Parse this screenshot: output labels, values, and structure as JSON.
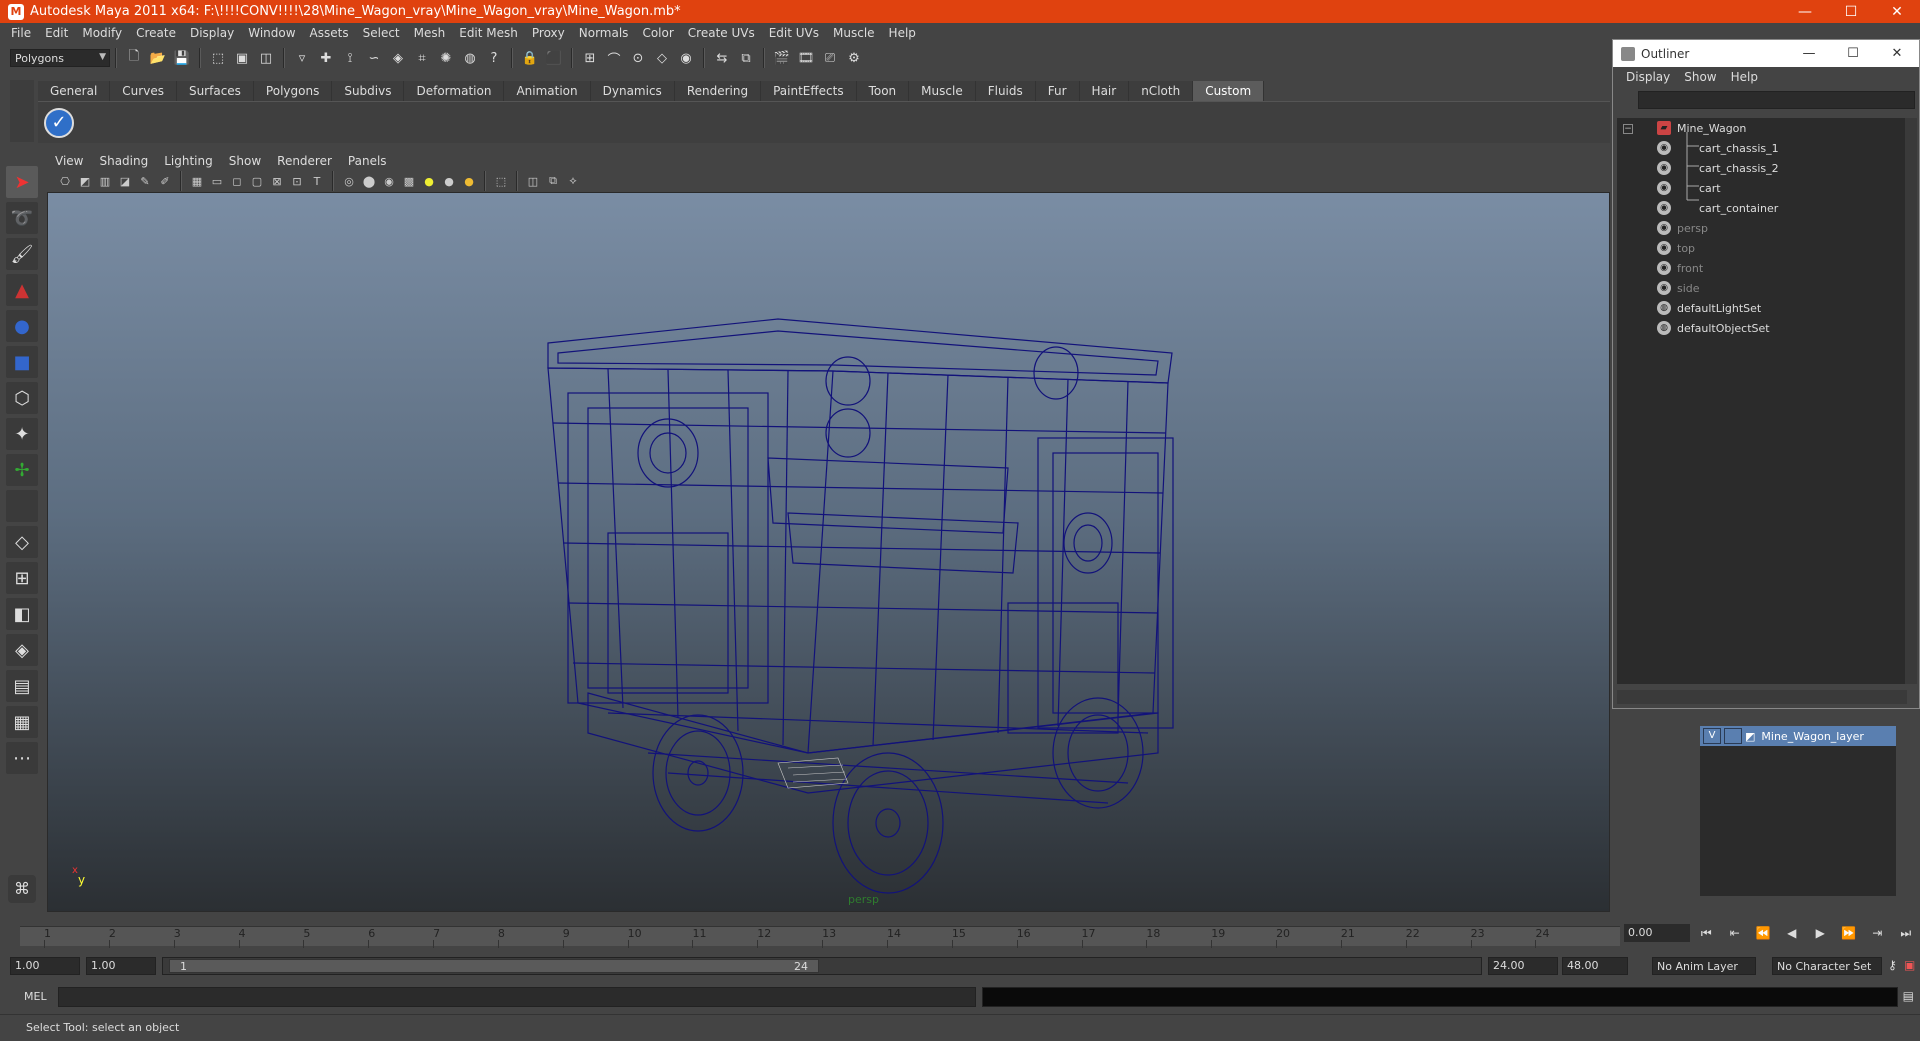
{
  "window": {
    "title": "Autodesk Maya 2011 x64: F:\\!!!!CONV!!!!\\28\\Mine_Wagon_vray\\Mine_Wagon_vray\\Mine_Wagon.mb*",
    "minimize": "—",
    "maximize": "☐",
    "close": "✕"
  },
  "menubar": [
    "File",
    "Edit",
    "Modify",
    "Create",
    "Display",
    "Window",
    "Assets",
    "Select",
    "Mesh",
    "Edit Mesh",
    "Proxy",
    "Normals",
    "Color",
    "Create UVs",
    "Edit UVs",
    "Muscle",
    "Help"
  ],
  "statusline": {
    "mode": "Polygons"
  },
  "shelf": {
    "tabs": [
      "General",
      "Curves",
      "Surfaces",
      "Polygons",
      "Subdivs",
      "Deformation",
      "Animation",
      "Dynamics",
      "Rendering",
      "PaintEffects",
      "Toon",
      "Muscle",
      "Fluids",
      "Fur",
      "Hair",
      "nCloth",
      "Custom"
    ],
    "active_tab": "Custom"
  },
  "panel": {
    "menu": [
      "View",
      "Shading",
      "Lighting",
      "Show",
      "Renderer",
      "Panels"
    ],
    "camera_label": "persp",
    "axis_x": "x",
    "axis_y": "y"
  },
  "outliner": {
    "title": "Outliner",
    "menu": [
      "Display",
      "Show",
      "Help"
    ],
    "items": [
      {
        "label": "Mine_Wagon",
        "level": 0,
        "dim": false
      },
      {
        "label": "cart_chassis_1",
        "level": 1,
        "dim": false
      },
      {
        "label": "cart_chassis_2",
        "level": 1,
        "dim": false
      },
      {
        "label": "cart",
        "level": 1,
        "dim": false
      },
      {
        "label": "cart_container",
        "level": 1,
        "dim": false
      },
      {
        "label": "persp",
        "level": 0,
        "dim": true
      },
      {
        "label": "top",
        "level": 0,
        "dim": true
      },
      {
        "label": "front",
        "level": 0,
        "dim": true
      },
      {
        "label": "side",
        "level": 0,
        "dim": true
      },
      {
        "label": "defaultLightSet",
        "level": 0,
        "dim": false
      },
      {
        "label": "defaultObjectSet",
        "level": 0,
        "dim": false
      }
    ]
  },
  "layers": {
    "visible_flag": "V",
    "layer_name": "Mine_Wagon_layer"
  },
  "timeslider": {
    "ticks": [
      "1",
      "2",
      "3",
      "4",
      "5",
      "6",
      "7",
      "8",
      "9",
      "10",
      "11",
      "12",
      "13",
      "14",
      "15",
      "16",
      "17",
      "18",
      "19",
      "20",
      "21",
      "22",
      "23",
      "24"
    ],
    "current_frame": "0.00"
  },
  "range": {
    "start_time": "1.00",
    "playback_start": "1.00",
    "handle_start": "1",
    "handle_end": "24",
    "playback_end": "24.00",
    "end_time": "48.00",
    "anim_layer": "No Anim Layer",
    "character_set": "No Character Set"
  },
  "cmdline": {
    "label": "MEL"
  },
  "helpline": {
    "text": "Select Tool: select an object"
  },
  "colors": {
    "title_bar": "#e0420f",
    "wireframe": "#12127a",
    "layer_highlight": "#5a7fb0"
  }
}
